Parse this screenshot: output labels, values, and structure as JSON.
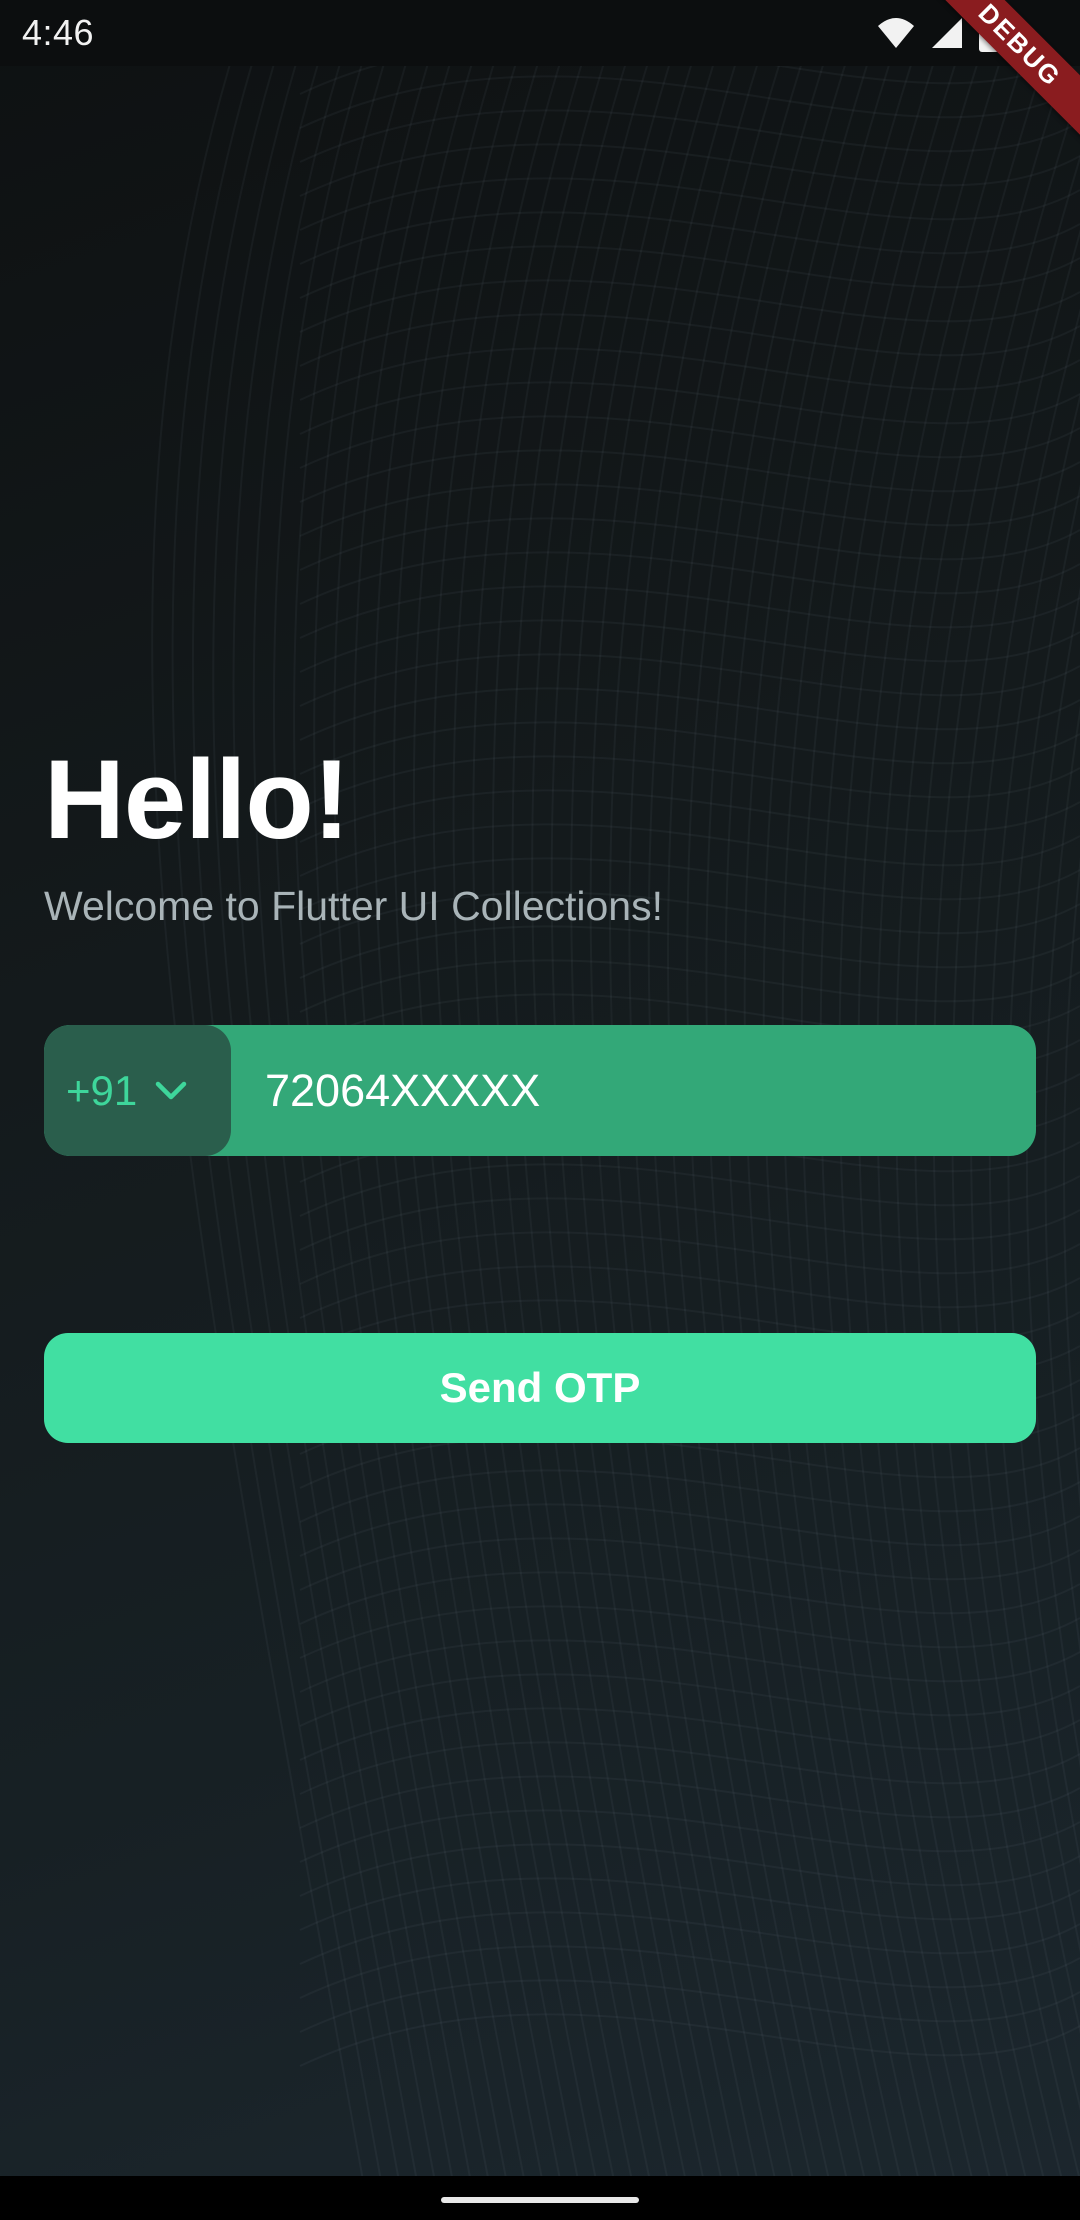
{
  "status_bar": {
    "time": "4:46",
    "icons": [
      "wifi-icon",
      "signal-icon",
      "battery-icon"
    ],
    "debug_label": "DEBUG"
  },
  "header": {
    "title": "Hello!",
    "subtitle": "Welcome to Flutter UI Collections!"
  },
  "phone_form": {
    "country_code": "+91",
    "country_icon": "chevron-down-icon",
    "phone_value": "72064XXXXX"
  },
  "actions": {
    "send_otp_label": "Send OTP"
  },
  "colors": {
    "accent": "#41dfa2",
    "input_fill": "#33a878",
    "picker_fill": "#2a5e4c",
    "debug_banner": "#8a1c1f"
  }
}
